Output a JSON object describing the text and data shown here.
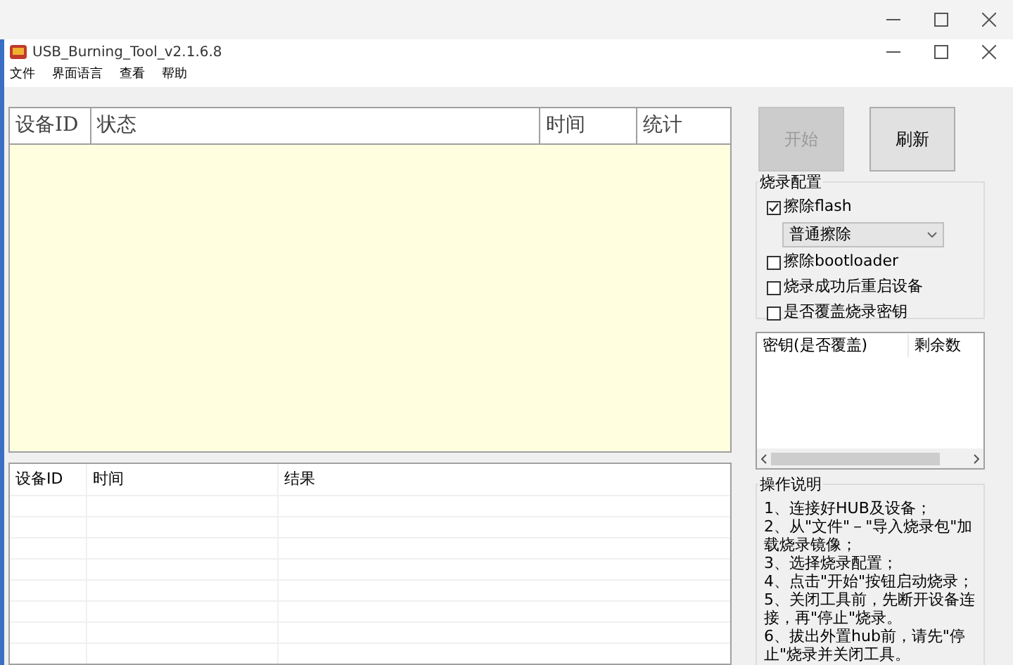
{
  "window": {
    "title": "USB_Burning_Tool_v2.1.6.8"
  },
  "menu": [
    "文件",
    "界面语言",
    "查看",
    "帮助"
  ],
  "device_table": {
    "columns": [
      "设备ID",
      "状态",
      "时间",
      "统计"
    ]
  },
  "result_table": {
    "columns": [
      "设备ID",
      "时间",
      "结果"
    ]
  },
  "buttons": [
    {
      "label": "开始",
      "disabled": true
    },
    {
      "label": "刷新",
      "disabled": false
    }
  ],
  "config": {
    "title": "烧录配置",
    "options": [
      {
        "kind": "checkbox",
        "label": "擦除flash",
        "checked": true
      },
      {
        "kind": "dropdown",
        "value": "普通擦除"
      },
      {
        "kind": "checkbox",
        "label": "擦除bootloader",
        "checked": false
      },
      {
        "kind": "checkbox",
        "label": "烧录成功后重启设备",
        "checked": false
      },
      {
        "kind": "checkbox",
        "label": "是否覆盖烧录密钥",
        "checked": false
      }
    ]
  },
  "key_table": {
    "columns": [
      "密钥(是否覆盖)",
      "剩余数"
    ]
  },
  "instructions": {
    "title": "操作说明",
    "lines": [
      "1、连接好HUB及设备；",
      "2、从\"文件\"－\"导入烧录包\"加载烧录镜像；",
      "3、选择烧录配置；",
      "4、点击\"开始\"按钮启动烧录；",
      "5、关闭工具前，先断开设备连接，再\"停止\"烧录。",
      "6、拔出外置hub前，请先\"停止\"烧录并关闭工具。"
    ]
  }
}
